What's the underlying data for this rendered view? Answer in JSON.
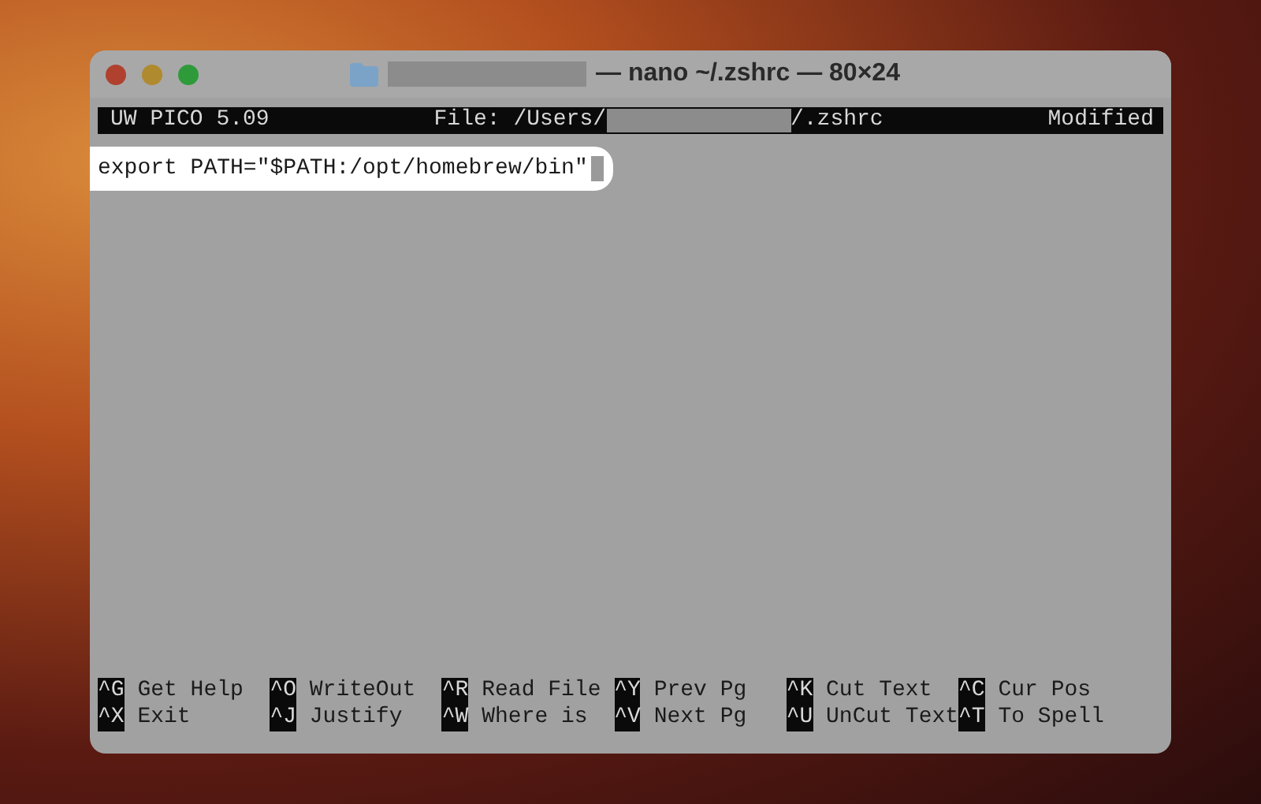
{
  "window": {
    "title": "— nano ~/.zshrc — 80×24"
  },
  "header": {
    "app": "UW PICO 5.09",
    "file_prefix": "File: /Users/",
    "file_suffix": "/.zshrc",
    "status": "Modified"
  },
  "lines": [
    {
      "text": "export PATH=\"$PATH:/opt/homebrew/bin\"",
      "highlighted": true
    }
  ],
  "shortcuts": [
    [
      {
        "key": "^G",
        "label": "Get Help"
      },
      {
        "key": "^O",
        "label": "WriteOut"
      },
      {
        "key": "^R",
        "label": "Read File"
      },
      {
        "key": "^Y",
        "label": "Prev Pg"
      },
      {
        "key": "^K",
        "label": "Cut Text"
      },
      {
        "key": "^C",
        "label": "Cur Pos"
      }
    ],
    [
      {
        "key": "^X",
        "label": "Exit"
      },
      {
        "key": "^J",
        "label": "Justify"
      },
      {
        "key": "^W",
        "label": "Where is"
      },
      {
        "key": "^V",
        "label": "Next Pg"
      },
      {
        "key": "^U",
        "label": "UnCut Text"
      },
      {
        "key": "^T",
        "label": "To Spell"
      }
    ]
  ]
}
